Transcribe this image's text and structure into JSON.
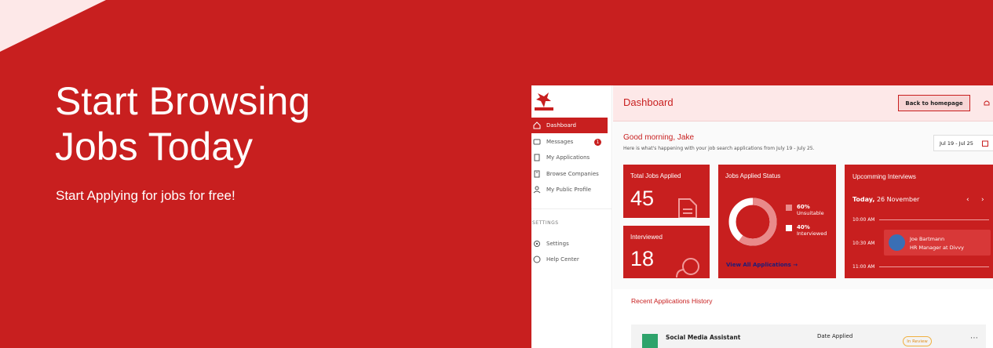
{
  "hero": {
    "title": "Start Browsing Jobs Today",
    "subtitle": "Start Applying for jobs for free!"
  },
  "sidebar": {
    "items": [
      {
        "label": "Dashboard",
        "icon": "home-icon",
        "active": true
      },
      {
        "label": "Messages",
        "icon": "message-icon",
        "badge": "1"
      },
      {
        "label": "My Applications",
        "icon": "document-icon"
      },
      {
        "label": "Browse Companies",
        "icon": "building-icon"
      },
      {
        "label": "My Public Profile",
        "icon": "user-icon"
      }
    ],
    "settings_heading": "SETTINGS",
    "settings_items": [
      {
        "label": "Settings",
        "icon": "gear-icon"
      },
      {
        "label": "Help Center",
        "icon": "help-icon"
      }
    ]
  },
  "topbar": {
    "title": "Dashboard",
    "back_button": "Back to homepage"
  },
  "greeting": {
    "title": "Good morning, Jake",
    "subtitle": "Here is what's happening with your job search applications from July 19 - July 25.",
    "date_range": "Jul 19 - Jul 25"
  },
  "stats": {
    "total_label": "Total Jobs Applied",
    "total_value": "45",
    "interviewed_label": "Interviewed",
    "interviewed_value": "18"
  },
  "status": {
    "title": "Jobs Applied Status",
    "unsuitable_pct": "60%",
    "unsuitable_label": "Unsuitable",
    "interviewed_pct": "40%",
    "interviewed_label": "Interviewed",
    "link": "View All Applications",
    "donut_fraction": 0.6
  },
  "interviews": {
    "title": "Upcomming Interviews",
    "day": "Today,",
    "date": "26 November",
    "times": [
      "10:00 AM",
      "10:30 AM",
      "11:00 AM"
    ],
    "event_name": "Joe Bartmann",
    "event_role": "HR Manager at Divvy"
  },
  "history": {
    "title": "Recent Applications History",
    "job_title": "Social Media Assistant",
    "date_label": "Date Applied",
    "status": "In Review"
  },
  "colors": {
    "brand": "#c81f1f",
    "donut_light": "#e98a8a",
    "donut_white": "#ffffff"
  }
}
